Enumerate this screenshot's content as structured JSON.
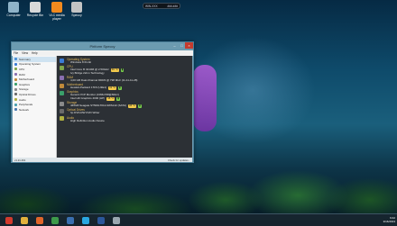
{
  "desktop": {
    "icons": [
      {
        "label": "Computer",
        "icon": "computer-icon",
        "color": "#8fb3c8"
      },
      {
        "label": "Recycle Bin",
        "icon": "recycle-bin-icon",
        "color": "#d9d9d9"
      },
      {
        "label": "VLC media player",
        "icon": "vlc-icon",
        "color": "#f28a1e"
      },
      {
        "label": "Speccy",
        "icon": "speccy-icon",
        "color": "#c4c4c4"
      }
    ],
    "top_pill": {
      "left": "WIN-XXX",
      "right": "###.###"
    }
  },
  "window": {
    "title": "Piriform Speccy",
    "menu": [
      "File",
      "View",
      "Help"
    ],
    "sidebar": [
      {
        "label": "Summary",
        "color": "#4a90d9",
        "active": true
      },
      {
        "label": "Operating System",
        "color": "#3a7bd5"
      },
      {
        "label": "CPU",
        "color": "#7fa64a"
      },
      {
        "label": "RAM",
        "color": "#8a6fb0"
      },
      {
        "label": "Motherboard",
        "color": "#c08a3a"
      },
      {
        "label": "Graphics",
        "color": "#3aa06a"
      },
      {
        "label": "Storage",
        "color": "#8a8a8a"
      },
      {
        "label": "Optical Drives",
        "color": "#6a6a6a"
      },
      {
        "label": "Audio",
        "color": "#b0b040"
      },
      {
        "label": "Peripherals",
        "color": "#4aa0b0"
      },
      {
        "label": "Network",
        "color": "#4a7ab0"
      }
    ],
    "sections": [
      {
        "head": "Operating System",
        "color": "#3a7bd5",
        "lines": [
          "Windows 8 64-bit"
        ]
      },
      {
        "head": "CPU",
        "color": "#7fa64a",
        "lines": [
          "Intel Core i5 3210M @ 2.50GHz",
          "Ivy Bridge 22nm Technology"
        ],
        "temp": "49 °C",
        "temp_line": 0
      },
      {
        "head": "RAM",
        "color": "#8a6fb0",
        "lines": [
          "4,00 GB Dual-Channel DDR3 @ 798 MHz (11-11-11-28)"
        ]
      },
      {
        "head": "Motherboard",
        "color": "#c08a3a",
        "lines": [
          "Hewlett-Packard 17F6 (U3E1)"
        ],
        "temp": "43 °C",
        "temp_line": 0
      },
      {
        "head": "Graphics",
        "color": "#3aa06a",
        "lines": [
          "Generic PnP Monitor (1366x768@60Hz)",
          "Intel HD Graphics 4000 (HP)"
        ],
        "temp": "48 °C",
        "temp_line": 1
      },
      {
        "head": "Storage",
        "color": "#8a8a8a",
        "lines": [
          "465GB Seagate ST500LT012-9WS142 (SATA)"
        ],
        "temp": "38 °C",
        "temp_line": 0
      },
      {
        "head": "Optical Drives",
        "color": "#6a6a6a",
        "lines": [
          "hp DVD-RW DVD Writer"
        ]
      },
      {
        "head": "Audio",
        "color": "#b0b040",
        "lines": [
          "High Definition Audio Device"
        ]
      }
    ],
    "status": {
      "left": "v1.21.491",
      "right": "Check for updates..."
    }
  },
  "taskbar": {
    "apps": [
      {
        "icon": "start-icon",
        "color": "#d23b2e"
      },
      {
        "icon": "file-explorer-icon",
        "color": "#e2b13c"
      },
      {
        "icon": "firefox-icon",
        "color": "#e0662b"
      },
      {
        "icon": "chrome-icon",
        "color": "#3d9a4a"
      },
      {
        "icon": "media-player-icon",
        "color": "#3a6fb0"
      },
      {
        "icon": "skype-icon",
        "color": "#2aa7e0"
      },
      {
        "icon": "word-icon",
        "color": "#2b579a"
      },
      {
        "icon": "speccy-icon",
        "color": "#9aa7b0"
      }
    ],
    "clock": {
      "time": "9:42",
      "date": "3/16/2013"
    }
  }
}
